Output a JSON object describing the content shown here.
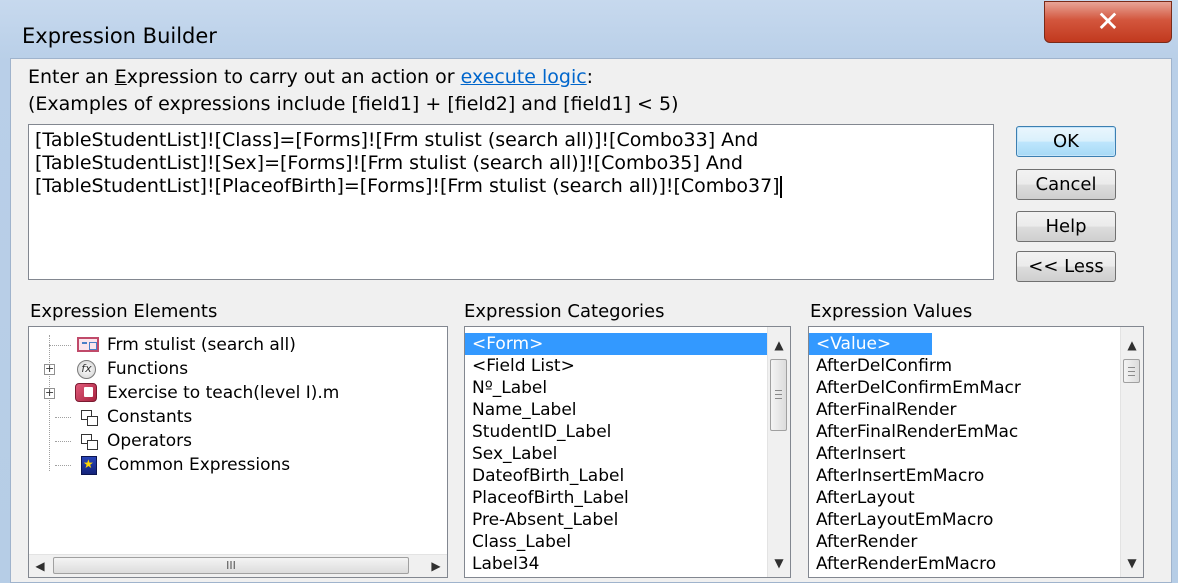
{
  "dialog": {
    "title": "Expression Builder",
    "close_glyph": "✕"
  },
  "instructions": {
    "prefix": "Enter an ",
    "underlined_letter": "E",
    "middle": "xpression to carry out an action or ",
    "link": "execute logic",
    "suffix": ":",
    "examples": "(Examples of expressions include [field1] + [field2] and [field1] < 5)"
  },
  "expression": {
    "lines": [
      "[TableStudentList]![Class]=[Forms]![Frm stulist (search all)]![Combo33] And",
      "[TableStudentList]![Sex]=[Forms]![Frm stulist (search all)]![Combo35] And",
      "[TableStudentList]![PlaceofBirth]=[Forms]![Frm stulist (search all)]![Combo37]"
    ]
  },
  "buttons": {
    "ok": "OK",
    "cancel": "Cancel",
    "help": "Help",
    "less": "<< Less"
  },
  "elements": {
    "header": "Expression Elements",
    "items": [
      {
        "label": "Frm stulist (search all)",
        "icon": "form-icon",
        "expandable": false
      },
      {
        "label": "Functions",
        "icon": "function-icon",
        "expandable": true
      },
      {
        "label": "Exercise to teach(level I).m",
        "icon": "database-icon",
        "expandable": true
      },
      {
        "label": "Constants",
        "icon": "constants-icon",
        "expandable": false
      },
      {
        "label": "Operators",
        "icon": "operators-icon",
        "expandable": false
      },
      {
        "label": "Common Expressions",
        "icon": "common-expressions-icon",
        "expandable": false
      }
    ],
    "hscroll_grip": "III"
  },
  "categories": {
    "header": "Expression Categories",
    "items": [
      "<Form>",
      "<Field List>",
      "Nº_Label",
      "Name_Label",
      "StudentID_Label",
      "Sex_Label",
      "DateofBirth_Label",
      "PlaceofBirth_Label",
      "Pre-Absent_Label",
      "Class_Label",
      "Label34"
    ],
    "selected_index": 0
  },
  "values": {
    "header": "Expression Values",
    "items": [
      "<Value>",
      "AfterDelConfirm",
      "AfterDelConfirmEmMacr",
      "AfterFinalRender",
      "AfterFinalRenderEmMac",
      "AfterInsert",
      "AfterInsertEmMacro",
      "AfterLayout",
      "AfterLayoutEmMacro",
      "AfterRender",
      "AfterRenderEmMacro"
    ],
    "selected_index": 0
  },
  "colors": {
    "selection": "#3399ff",
    "link": "#0066cc",
    "close_button": "#c1391e"
  }
}
